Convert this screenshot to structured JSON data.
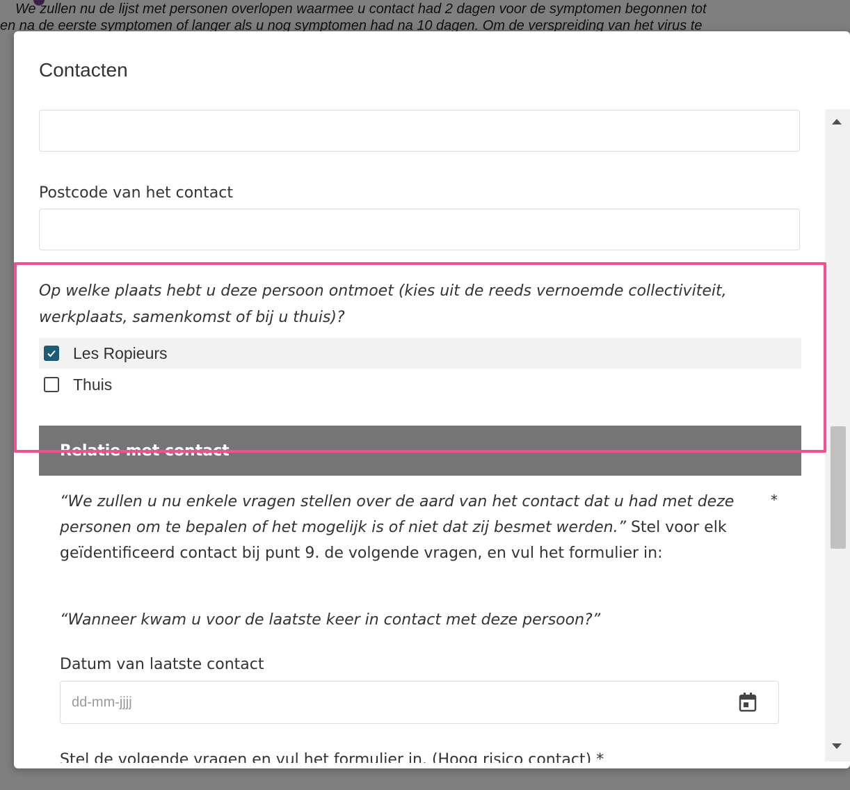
{
  "background": {
    "line_1": "We zullen nu de lijst met personen overlopen waarmee u contact had 2 dagen voor de symptomen begonnen tot",
    "line_2": "en na de eerste symptomen of langer als u nog symptomen had na 10 dagen. Om de verspreiding van het virus te"
  },
  "modal": {
    "title": "Contacten",
    "postcode_label": "Postcode van het contact",
    "location_question": "Op welke plaats hebt u deze persoon ontmoet (kies uit de reeds vernoemde collectiviteit, werkplaats, samenkomst of bij u thuis)?",
    "location_options": [
      {
        "label": "Les Ropieurs",
        "checked": true
      },
      {
        "label": "Thuis",
        "checked": false
      }
    ],
    "section_title": "Relatie met contact",
    "section_note_quote": "“We zullen u nu enkele vragen stellen over de aard van het contact dat u had met deze personen om te bepalen of het mogelijk is of niet dat zij besmet werden.”",
    "section_note_rest": " Stel voor elk geïdentificeerd contact bij punt 9. de volgende vragen, en vul het formulier in:",
    "required_mark": "*",
    "last_contact_question": "“Wanneer kwam u voor de laatste keer in contact met deze persoon?”",
    "date_label": "Datum van laatste contact",
    "date_placeholder": "dd-mm-jjjj",
    "next_question_cut": "Stel de volgende vragen en vul het formulier in. (Hoog risico contact) *"
  },
  "colors": {
    "checkbox_checked": "#1d5a73",
    "section_header": "#757575",
    "highlight": "#f2508f"
  },
  "icons": [
    "check-icon",
    "calendar-icon",
    "scroll-up-arrow-icon",
    "scroll-down-arrow-icon"
  ]
}
